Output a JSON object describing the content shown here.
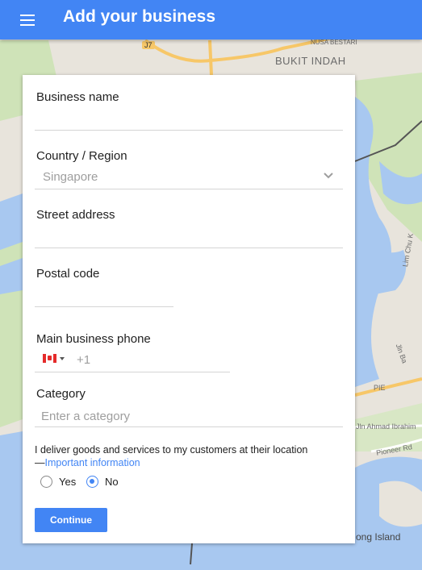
{
  "header": {
    "title": "Add your business"
  },
  "map": {
    "labels": {
      "area_bukit_indah": "BUKIT INDAH",
      "area_top_small": "NUSA BESTARI",
      "road_badge": "J7",
      "road_lim_chu": "Lim Chu K",
      "road_jln_ba": "Jln Ba",
      "road_pie": "PIE",
      "road_jln_ahmad": "Jln Ahmad Ibrahim",
      "road_pioneer": "Pioneer Rd",
      "area_island": "ong Island"
    },
    "colors": {
      "land": "#e8e4dc",
      "green": "#cfe3b8",
      "water": "#a8c8f0",
      "road": "#f7c768"
    }
  },
  "form": {
    "business_name": {
      "label": "Business name",
      "value": ""
    },
    "country": {
      "label": "Country / Region",
      "value": "Singapore"
    },
    "street": {
      "label": "Street address",
      "value": ""
    },
    "postal": {
      "label": "Postal code",
      "value": ""
    },
    "phone": {
      "label": "Main business phone",
      "prefix": "+1",
      "flag": "canada-flag-icon"
    },
    "category": {
      "label": "Category",
      "placeholder": "Enter a category"
    },
    "delivery": {
      "text": "I deliver goods and services to my customers at their location",
      "dash": "—",
      "link": "Important information",
      "options": [
        {
          "label": "Yes",
          "selected": false
        },
        {
          "label": "No",
          "selected": true
        }
      ]
    },
    "continue_label": "Continue"
  },
  "colors": {
    "accent": "#4285f4"
  }
}
